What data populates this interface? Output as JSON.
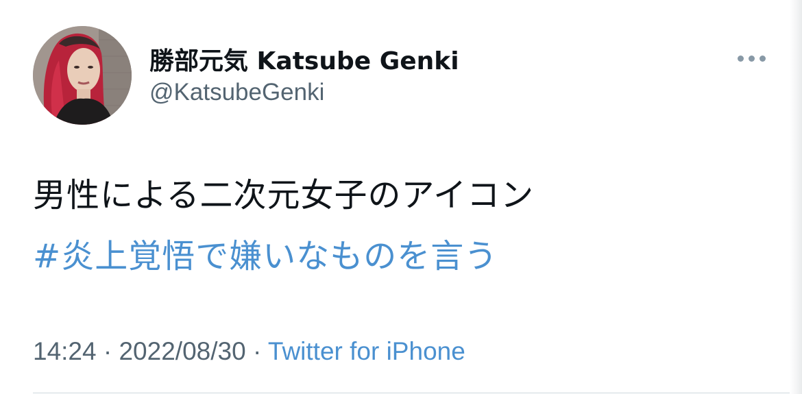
{
  "user": {
    "display_name": "勝部元気 Katsube Genki",
    "handle": "@KatsubeGenki"
  },
  "tweet": {
    "text": "男性による二次元女子のアイコン",
    "hashtag": "#炎上覚悟で嫌いなものを言う"
  },
  "meta": {
    "time": "14:24",
    "separator": " · ",
    "date": "2022/08/30",
    "source": "Twitter for iPhone"
  },
  "colors": {
    "link": "#4a90d0",
    "secondary_text": "#536471",
    "primary_text": "#0f1419"
  }
}
